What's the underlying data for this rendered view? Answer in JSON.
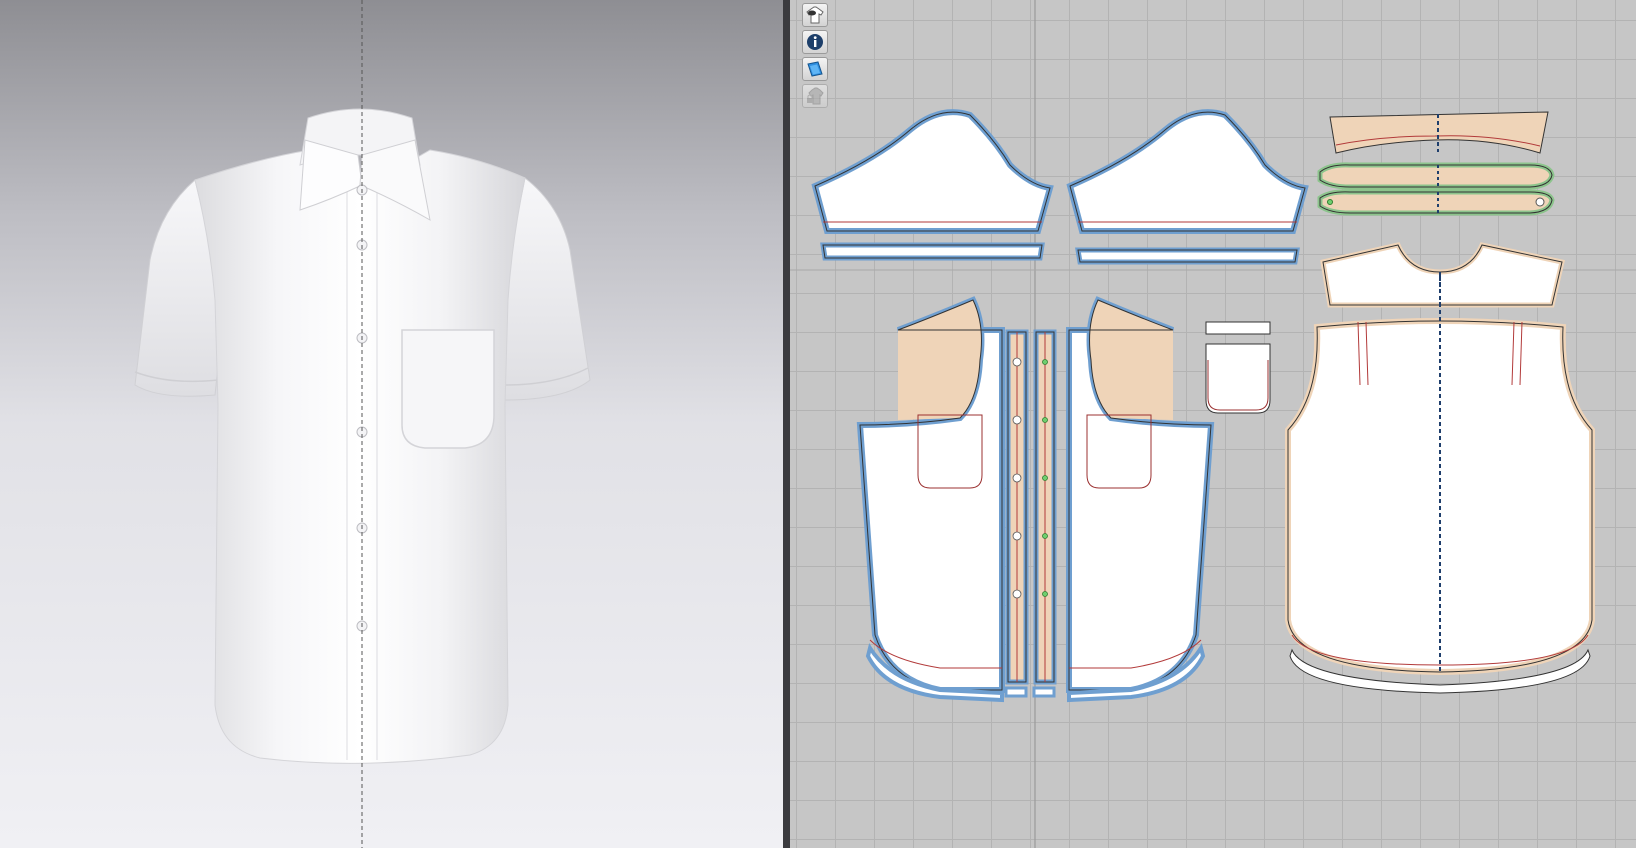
{
  "app": {
    "views": [
      "3d-avatar-window",
      "2d-pattern-window"
    ]
  },
  "toolbar": {
    "tools": [
      {
        "icon": "garment-visibility-icon",
        "state": "normal"
      },
      {
        "icon": "info-icon",
        "state": "normal"
      },
      {
        "icon": "texture-view-icon",
        "state": "active"
      },
      {
        "icon": "lock-garment-icon",
        "state": "disabled"
      }
    ]
  },
  "colors": {
    "pattern_fill": "#ffffff",
    "selected_outline": "#6f9fd0",
    "seam_allowance": "#efd4b8",
    "internal_line": "#9b3030",
    "fold_line": "#1e3e6c",
    "green_piece": "#b4dcb4",
    "grid_bg": "#c6c6c6",
    "viewport_3d_top": "#8e8e93",
    "viewport_3d_bottom": "#f0f0f4"
  },
  "garment": {
    "type": "short-sleeve-shirt",
    "color": "#ffffff",
    "front_buttons": 6,
    "chest_pocket": true
  },
  "pattern_pieces": [
    "sleeve-left",
    "sleeve-right",
    "cuff-left",
    "cuff-right",
    "front-left",
    "front-right",
    "placket-left",
    "placket-right",
    "pocket",
    "pocket-flap",
    "collar",
    "collar-stand",
    "collar-stand-inner",
    "yoke",
    "back"
  ]
}
